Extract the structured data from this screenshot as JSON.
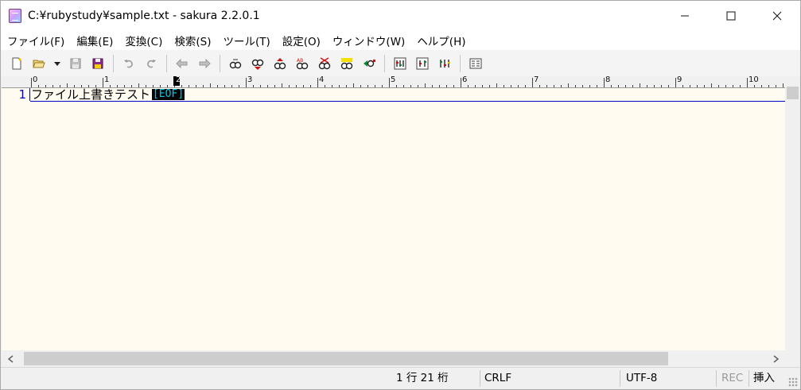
{
  "window": {
    "title": "C:¥rubystudy¥sample.txt - sakura 2.2.0.1"
  },
  "menu": {
    "items": [
      "ファイル(F)",
      "編集(E)",
      "変換(C)",
      "検索(S)",
      "ツール(T)",
      "設定(O)",
      "ウィンドウ(W)",
      "ヘルプ(H)"
    ]
  },
  "toolbar": {
    "groups": [
      [
        "new-file-icon",
        "open-file-icon",
        "dropdown-arrow-icon",
        "save-icon",
        "save-as-icon"
      ],
      [
        "undo-icon",
        "redo-icon"
      ],
      [
        "jump-back-icon",
        "jump-forward-icon"
      ],
      [
        "search-icon",
        "search-next-icon",
        "search-prev-icon",
        "replace-icon",
        "grep-icon",
        "highlight-icon",
        "tag-jump-icon"
      ],
      [
        "settings-common-icon",
        "settings-type-icon",
        "settings-font-icon"
      ],
      [
        "outline-icon"
      ]
    ]
  },
  "ruler": {
    "labels": [
      "0",
      "1",
      "2",
      "3",
      "4",
      "5",
      "6",
      "7",
      "8",
      "9",
      "10"
    ]
  },
  "editor": {
    "line_number": "1",
    "line_text": "ファイル上書きテスト",
    "eof_marker": "[EOF]"
  },
  "status": {
    "position": "1 行   21 桁",
    "line_ending": "CRLF",
    "encoding": "UTF-8",
    "rec": "REC",
    "insert_mode": "挿入"
  },
  "colors": {
    "editor_background": "#fffbf0",
    "line_number": "#0000c8",
    "eof_foreground": "#00c8e6",
    "eof_background": "#000000"
  }
}
